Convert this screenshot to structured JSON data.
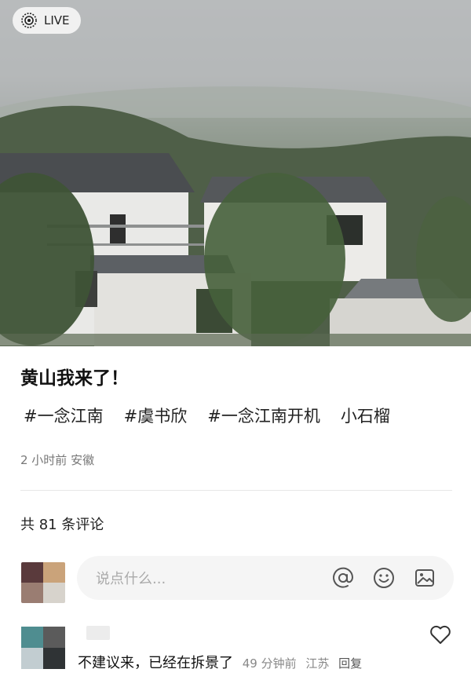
{
  "photo": {
    "badge_label": "LIVE",
    "badge_icon": "live-icon"
  },
  "post": {
    "title": "黄山我来了！",
    "tags": [
      "#一念江南",
      "#虞书欣",
      "#一念江南开机",
      "小石榴"
    ],
    "time": "2 小时前",
    "location": "安徽"
  },
  "comments": {
    "count_label": "共 81 条评论",
    "input_placeholder": "说点什么...",
    "input_icons": [
      "at-icon",
      "emoji-icon",
      "image-icon"
    ],
    "items": [
      {
        "text": "不建议来，已经在拆景了",
        "time": "49 分钟前",
        "location": "江苏",
        "reply_label": "回复"
      }
    ]
  },
  "colors": {
    "text": "#222222",
    "meta": "#777777",
    "input_bg": "#f5f5f5"
  }
}
